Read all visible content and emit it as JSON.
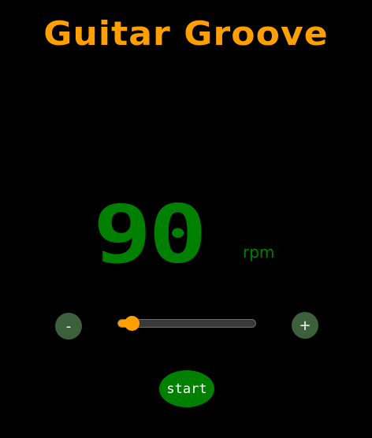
{
  "app": {
    "title": "Guitar Groove"
  },
  "tempo": {
    "value": "90",
    "unit": "rpm"
  },
  "controls": {
    "decrease_label": "-",
    "increase_label": "+",
    "slider_value_fraction": 0.1,
    "start_label": "start"
  },
  "colors": {
    "background": "#000000",
    "title": "#ffa000",
    "tempo": "#008000",
    "slider_accent": "#ffa000",
    "round_button": "#3c5f3c",
    "start_button": "#008000"
  }
}
